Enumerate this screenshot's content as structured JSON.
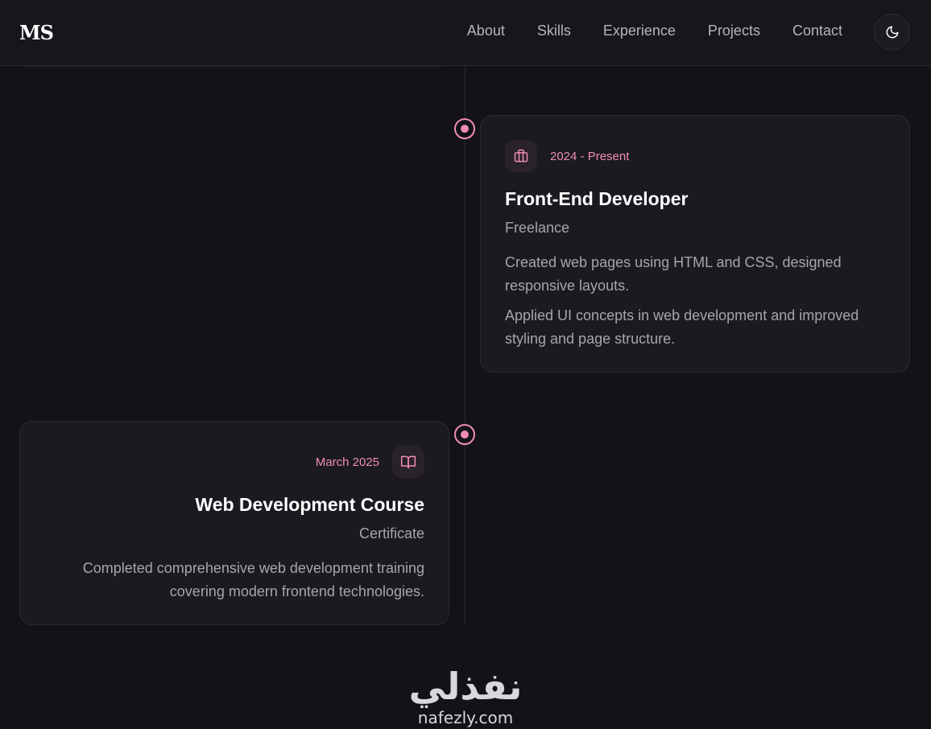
{
  "header": {
    "logo": "MS",
    "nav": [
      "About",
      "Skills",
      "Experience",
      "Projects",
      "Contact"
    ],
    "theme_toggle_icon": "moon-icon"
  },
  "timeline": [
    {
      "side": "right",
      "icon": "briefcase-icon",
      "date": "2024 - Present",
      "title": "Front-End Developer",
      "org": "Freelance",
      "descriptions": [
        "Created web pages using HTML and CSS, designed responsive layouts.",
        "Applied UI concepts in web development and improved styling and page structure."
      ]
    },
    {
      "side": "left",
      "icon": "book-icon",
      "date": "March 2025",
      "title": "Web Development Course",
      "org": "Certificate",
      "descriptions": [
        "Completed comprehensive web development training covering modern frontend technologies."
      ]
    }
  ],
  "accent_color": "#f08cb6",
  "watermark": {
    "arabic": "نفذلي",
    "latin": "nafezly.com"
  }
}
